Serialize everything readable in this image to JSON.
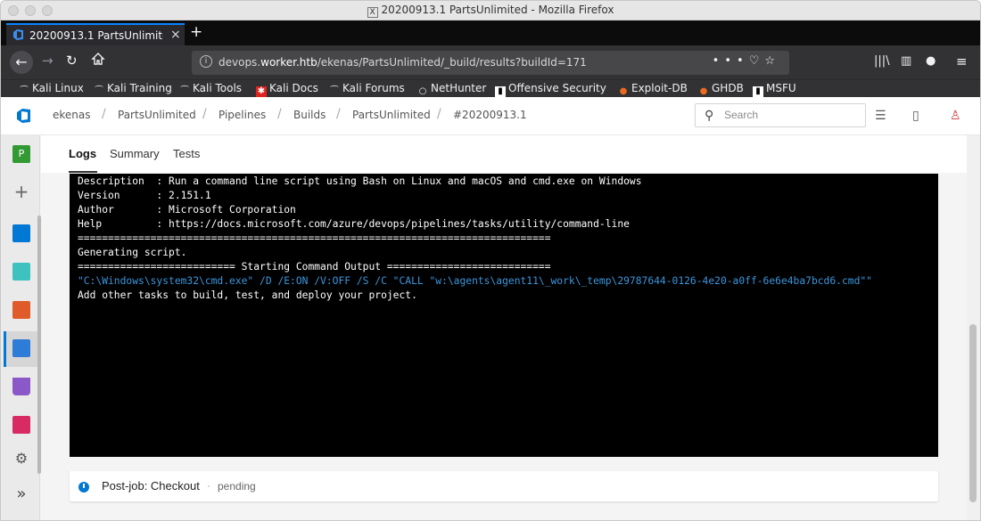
{
  "window": {
    "title": "20200913.1 PartsUnlimited - Mozilla Firefox"
  },
  "browser": {
    "tab_title": "20200913.1 PartsUnlimited",
    "url_prefix": "devops.",
    "url_domain": "worker.htb",
    "url_path": "/ekenas/PartsUnlimited/_build/results?buildId=171",
    "bookmarks": [
      {
        "label": "Kali Linux",
        "icon": "kali-dragon-icon"
      },
      {
        "label": "Kali Training",
        "icon": "kali-dragon-icon"
      },
      {
        "label": "Kali Tools",
        "icon": "kali-dragon-icon"
      },
      {
        "label": "Kali Docs",
        "icon": "kali-docs-icon"
      },
      {
        "label": "Kali Forums",
        "icon": "kali-dragon-icon"
      },
      {
        "label": "NetHunter",
        "icon": "nethunter-icon"
      },
      {
        "label": "Offensive Security",
        "icon": "offsec-icon"
      },
      {
        "label": "Exploit-DB",
        "icon": "exploitdb-icon"
      },
      {
        "label": "GHDB",
        "icon": "exploitdb-icon"
      },
      {
        "label": "MSFU",
        "icon": "offsec-icon"
      }
    ]
  },
  "devops": {
    "breadcrumbs": [
      "ekenas",
      "PartsUnlimited",
      "Pipelines",
      "Builds",
      "PartsUnlimited",
      "#20200913.1"
    ],
    "search_placeholder": "Search",
    "project_badge": "P",
    "tabs": [
      {
        "label": "Logs",
        "active": true
      },
      {
        "label": "Summary",
        "active": false
      },
      {
        "label": "Tests",
        "active": false
      }
    ],
    "console_lines": [
      {
        "text": "Description  : Run a command line script using Bash on Linux and macOS and cmd.exe on Windows",
        "kind": "normal"
      },
      {
        "text": "Version      : 2.151.1",
        "kind": "normal"
      },
      {
        "text": "Author       : Microsoft Corporation",
        "kind": "normal"
      },
      {
        "text": "Help         : https://docs.microsoft.com/azure/devops/pipelines/tasks/utility/command-line",
        "kind": "normal"
      },
      {
        "text": "==============================================================================",
        "kind": "normal"
      },
      {
        "text": "Generating script.",
        "kind": "normal"
      },
      {
        "text": "========================== Starting Command Output ===========================",
        "kind": "normal"
      },
      {
        "text": "\"C:\\Windows\\system32\\cmd.exe\" /D /E:ON /V:OFF /S /C \"CALL \"w:\\agents\\agent11\\_work\\_temp\\29787644-0126-4e20-a0ff-6e6e4ba7bcd6.cmd\"\"",
        "kind": "cmd"
      },
      {
        "text": "Add other tasks to build, test, and deploy your project.",
        "kind": "normal"
      }
    ],
    "post_job": {
      "label": "Post-job: Checkout",
      "separator": "·",
      "status": "pending"
    }
  },
  "colors": {
    "accent": "#0078d4",
    "console_bg": "#000000",
    "cmd_text": "#3a96dd"
  }
}
